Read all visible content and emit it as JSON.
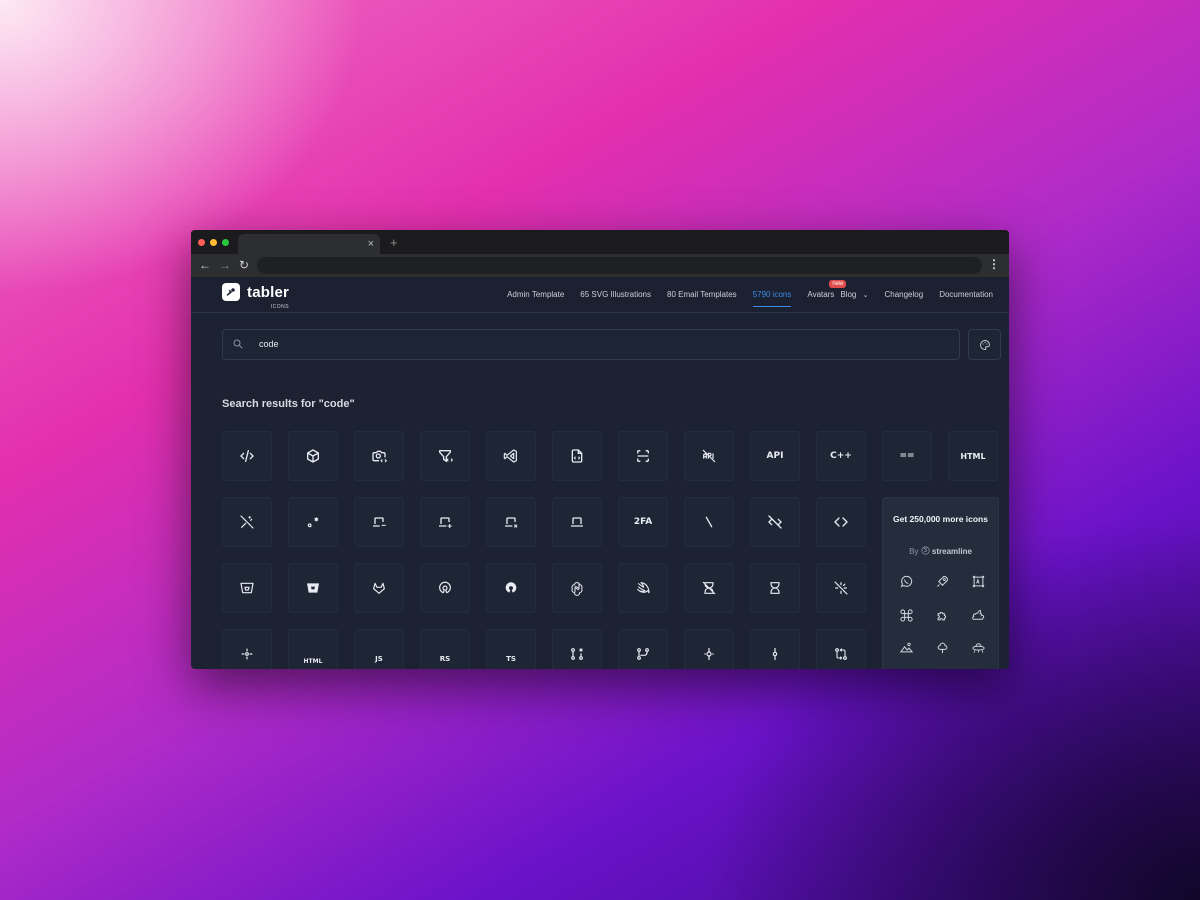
{
  "browser": {
    "tab_close": "×",
    "new_tab": "+",
    "back": "←",
    "forward": "→",
    "reload": "↻",
    "menu": "⋮"
  },
  "header": {
    "logo_text": "tabler",
    "logo_sub": "ICONS",
    "nav": [
      {
        "label": "Admin Template"
      },
      {
        "label": "65 SVG Illustrations"
      },
      {
        "label": "80 Email Templates"
      },
      {
        "label": "5790 icons",
        "active": true
      },
      {
        "label": "Avatars",
        "badge": "new"
      },
      {
        "label": "Blog",
        "chevron": "⌄"
      },
      {
        "label": "Changelog"
      },
      {
        "label": "Documentation"
      }
    ]
  },
  "search": {
    "value": "code"
  },
  "results": {
    "title": "Search results for \"code\"",
    "icons_row1": [
      "code-icon",
      "box-icon",
      "camera-code-icon",
      "filter-code-icon",
      "brand-visual-studio-icon",
      "file-code-icon",
      "scan-code-icon",
      "api-off-icon",
      "api-icon",
      "brand-cpp-icon",
      "equal-double-icon",
      "html-icon"
    ],
    "text_labels": {
      "api": "API",
      "cpp": "C++",
      "eq": "==",
      "html": "HTML",
      "twofa": "2FA",
      "html_file": "HTML",
      "js": "JS",
      "rs": "RS",
      "ts": "TS"
    }
  },
  "promo": {
    "title": "Get 250,000 more icons",
    "by_prefix": "By",
    "by_brand": "streamline"
  }
}
